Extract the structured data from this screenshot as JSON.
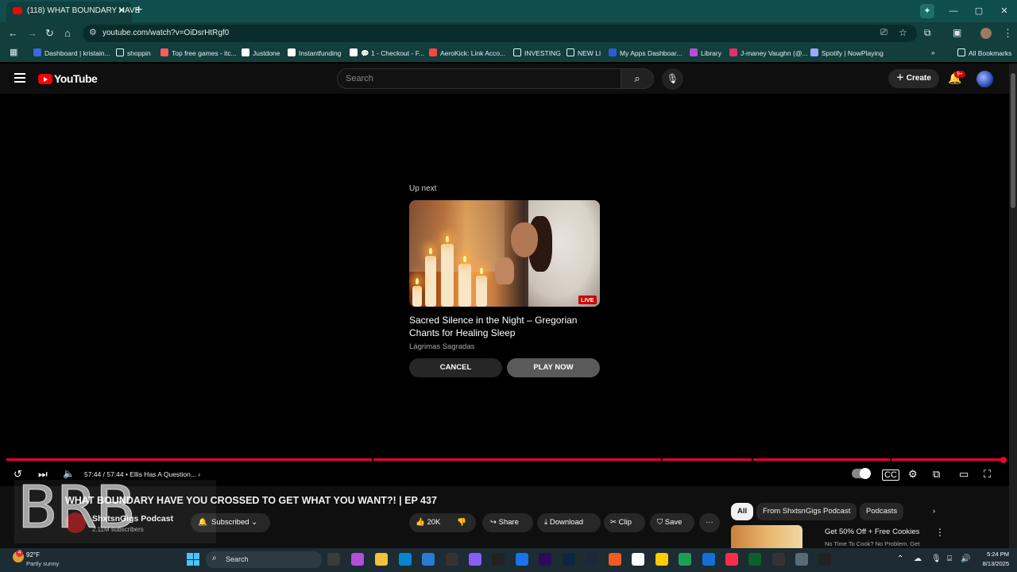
{
  "browser": {
    "tab_title": "(118) WHAT BOUNDARY HAVE",
    "tab_close": "✕",
    "new_tab": "+",
    "url": "youtube.com/watch?v=OiDsrHtRgf0",
    "window_controls": [
      "—",
      "▢",
      "✕"
    ],
    "bookmarks": [
      {
        "label": "Dashboard | kristain...",
        "color": "#3a6bd6"
      },
      {
        "label": "shoppin",
        "color": "folder"
      },
      {
        "label": "Top free games - itc...",
        "color": "#fa5c5c"
      },
      {
        "label": "Justdone",
        "color": "#ffffff"
      },
      {
        "label": "Instantfunding",
        "color": "#ffffff"
      },
      {
        "label": "💬 1 - Checkout - F...",
        "color": "#ffffff"
      },
      {
        "label": "AeroKick: Link Acco...",
        "color": "#ff4444"
      },
      {
        "label": "INVESTING",
        "color": "folder"
      },
      {
        "label": "NEW LI",
        "color": "folder"
      },
      {
        "label": "My Apps Dashboar...",
        "color": "#2d5bd8"
      },
      {
        "label": "Library",
        "color": "#b64dd8"
      },
      {
        "label": "J-maney Vaughn (@...",
        "color": "#e1306c"
      },
      {
        "label": "Spotify | NowPlaying",
        "color": "#9aa8ff"
      }
    ],
    "more_bookmarks": "»",
    "all_bookmarks": "All Bookmarks"
  },
  "youtube": {
    "logo_text": "YouTube",
    "search_placeholder": "Search",
    "create_label": "Create",
    "notif_count": "9+",
    "up_next_label": "Up next",
    "up_next_title": "Sacred Silence in the Night – Gregorian Chants for Healing Sleep",
    "up_next_channel": "Lágrimas Sagradas",
    "live_badge": "LIVE",
    "cancel_label": "CANCEL",
    "play_now_label": "PLAY NOW",
    "progress_fraction": 1.0,
    "time_display": "57:44 / 57:44",
    "chapter": "• Ellis Has A Question...",
    "video_title": "WHAT BOUNDARY HAVE YOU CROSSED TO GET WHAT YOU WANT?! | EP 437",
    "channel_name": "ShxtsnGigs Podcast",
    "subs_count": "2.11M subscribers",
    "subscribed_label": "Subscribed",
    "like_count": "20K",
    "share_label": "Share",
    "download_label": "Download",
    "clip_label": "Clip",
    "save_label": "Save",
    "more_label": "···",
    "chips": [
      "All",
      "From ShxtsnGigs Podcast",
      "Podcasts"
    ],
    "ad_title": "Get 50% Off + Free Cookies",
    "ad_sub": "No Time To Cook? No Problem. Get",
    "overlay_text": "BRB"
  },
  "taskbar": {
    "weather_temp": "92°F",
    "weather_cond": "Partly sunny",
    "weather_badge": "4",
    "search_placeholder": "Search",
    "time": "5:24 PM",
    "date": "8/13/2025"
  }
}
